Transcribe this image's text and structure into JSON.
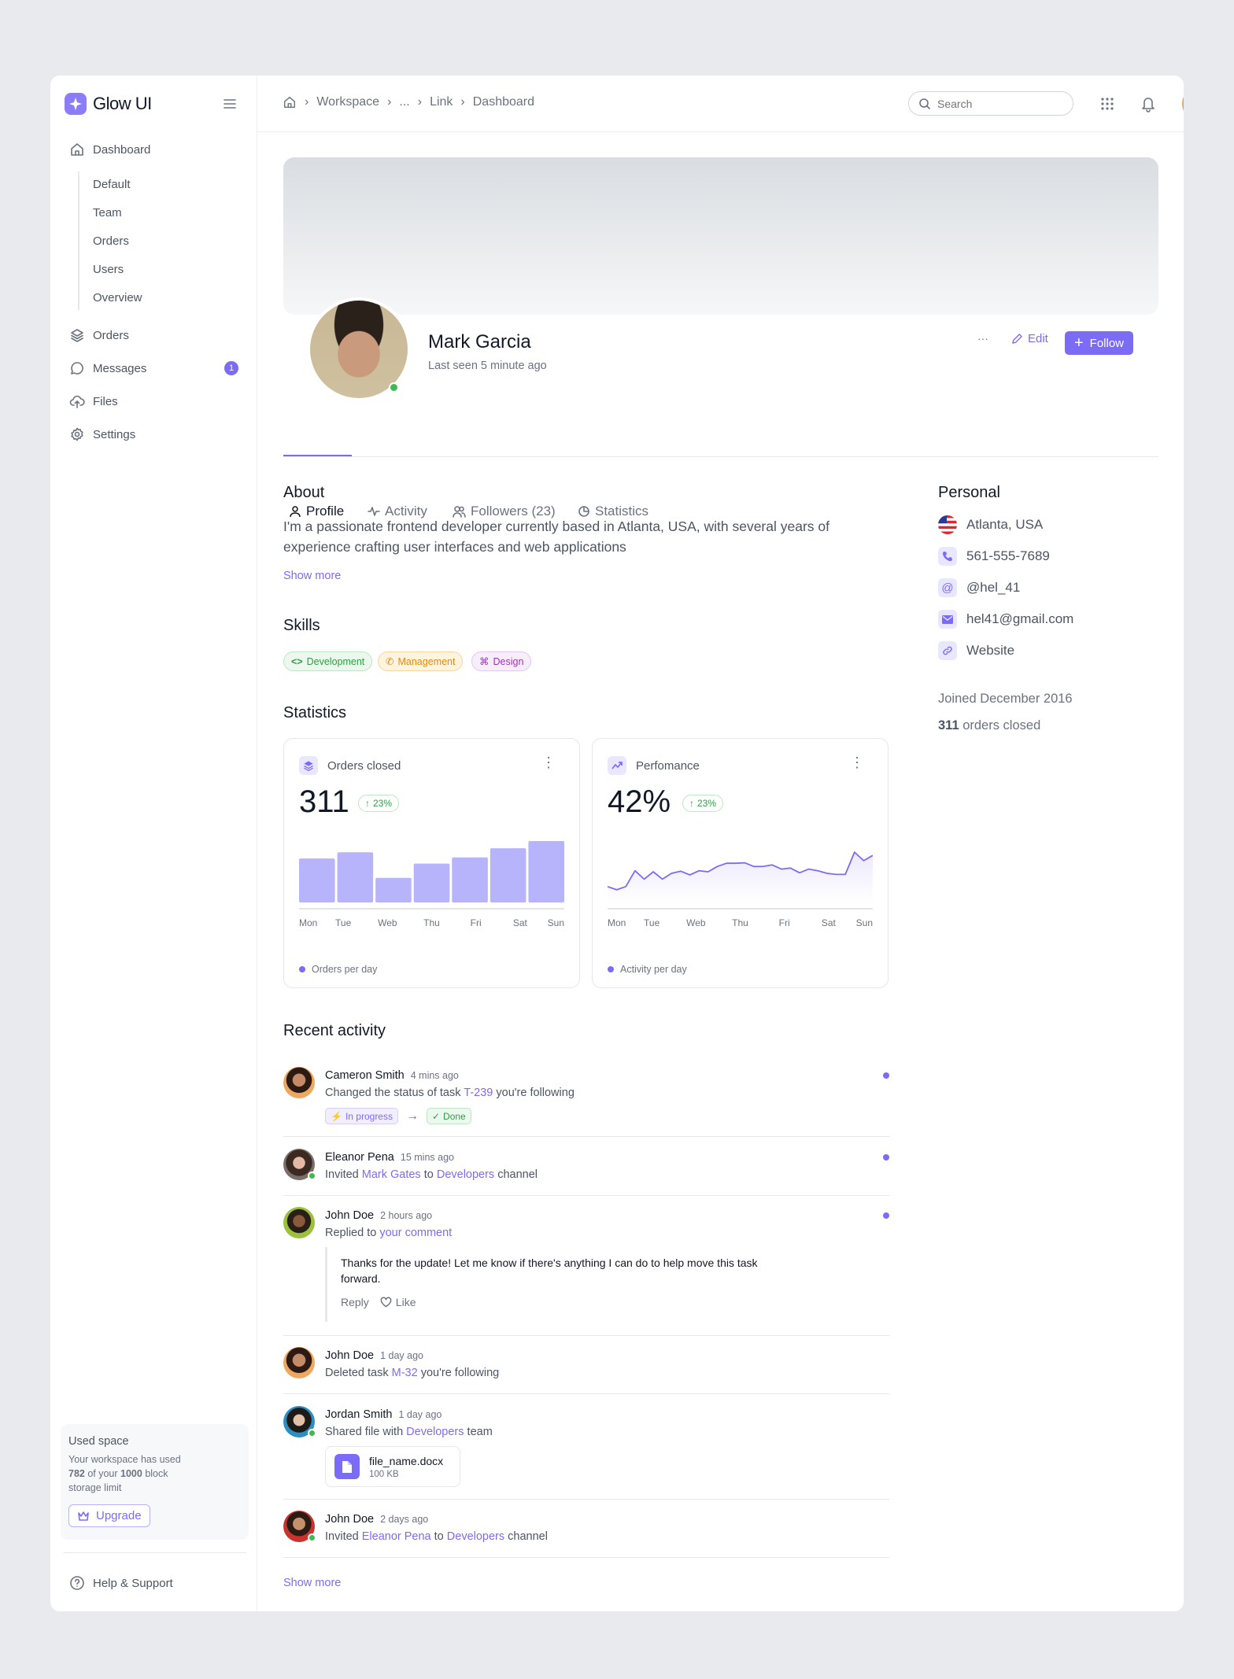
{
  "app": {
    "name": "Glow UI"
  },
  "sidebar": {
    "dashboard": "Dashboard",
    "sub_items": [
      "Default",
      "Team",
      "Orders",
      "Users",
      "Overview"
    ],
    "orders": "Orders",
    "messages": "Messages",
    "messages_badge": "1",
    "files": "Files",
    "settings": "Settings",
    "used_space": {
      "title": "Used space",
      "line1": "Your workspace has used",
      "used": "782",
      "of": " of your ",
      "limit": "1000",
      "line2_end": " block",
      "line3": "storage limit",
      "upgrade": "Upgrade"
    },
    "help": "Help & Support"
  },
  "header": {
    "breadcrumb": [
      "Workspace",
      "...",
      "Link",
      "Dashboard"
    ],
    "search_placeholder": "Search"
  },
  "profile": {
    "name": "Mark Garcia",
    "last_seen": "Last seen 5 minute ago",
    "more": "···",
    "edit": "Edit",
    "follow": "Follow"
  },
  "tabs": [
    "Profile",
    "Activity",
    "Followers (23)",
    "Statistics"
  ],
  "about": {
    "title": "About",
    "text": "I'm a passionate frontend developer currently based in Atlanta, USA, with several years of experience crafting user interfaces and web applications",
    "show_more": "Show more"
  },
  "skills": {
    "title": "Skills",
    "items": [
      "Development",
      "Management",
      "Design"
    ]
  },
  "statistics_title": "Statistics",
  "personal": {
    "title": "Personal",
    "location": "Atlanta, USA",
    "phone": "561-555-7689",
    "handle": "@hel_41",
    "email": "hel41@gmail.com",
    "website": "Website",
    "joined": "Joined December 2016",
    "orders_count": "311",
    "orders_text": " orders closed"
  },
  "colors": {
    "accent": "#7c6cf5",
    "bar": "#b8b4fb",
    "success": "#3fb950"
  },
  "chart_data": [
    {
      "type": "bar",
      "title": "Orders closed",
      "value": "311",
      "change": "23%",
      "categories": [
        "Mon",
        "Tue",
        "Web",
        "Thu",
        "Fri",
        "Sat",
        "Sun"
      ],
      "values": [
        43,
        49,
        24,
        38,
        44,
        53,
        60
      ],
      "ylim": [
        0,
        60
      ],
      "legend": "Orders per day",
      "grid": false
    },
    {
      "type": "area",
      "title": "Perfomance",
      "value": "42%",
      "change": "23%",
      "categories": [
        "Mon",
        "Tue",
        "Web",
        "Thu",
        "Fri",
        "Sat",
        "Sun"
      ],
      "values": [
        30,
        24,
        30,
        60,
        44,
        58,
        44,
        55,
        59,
        52,
        60,
        58,
        68,
        74,
        74,
        75,
        68,
        68,
        71,
        63,
        65,
        56,
        63,
        60,
        55,
        53,
        53,
        95,
        79,
        89
      ],
      "ylim": [
        0,
        116
      ],
      "legend": "Activity per day",
      "grid": false
    }
  ],
  "activity": {
    "title": "Recent activity",
    "items": [
      {
        "name": "Cameron Smith",
        "time": "4 mins ago",
        "pre": "Changed the status of task ",
        "link1": "T-239",
        "post": " you're following",
        "from": "In progress",
        "to": "Done"
      },
      {
        "name": "Eleanor Pena",
        "time": "15 mins ago",
        "pre": "Invited ",
        "link1": "Mark Gates",
        "mid": " to ",
        "link2": "Developers",
        "post": " channel"
      },
      {
        "name": "John Doe",
        "time": "2 hours ago",
        "pre": "Replied to ",
        "link1": "your comment",
        "quote": "Thanks for the update! Let me know if there's anything I can do to help move this task forward.",
        "reply": "Reply",
        "like": "Like"
      },
      {
        "name": "John Doe",
        "time": "1 day ago",
        "pre": "Deleted task ",
        "link1": "M-32",
        "post": " you're following"
      },
      {
        "name": "Jordan Smith",
        "time": "1 day ago",
        "pre": "Shared file with ",
        "link1": "Developers",
        "post": " team",
        "file_name": "file_name.docx",
        "file_size": "100 KB"
      },
      {
        "name": "John Doe",
        "time": "2 days ago",
        "pre": "Invited ",
        "link1": "Eleanor Pena",
        "mid": " to ",
        "link2": "Developers",
        "post": " channel"
      }
    ],
    "show_more": "Show more"
  }
}
